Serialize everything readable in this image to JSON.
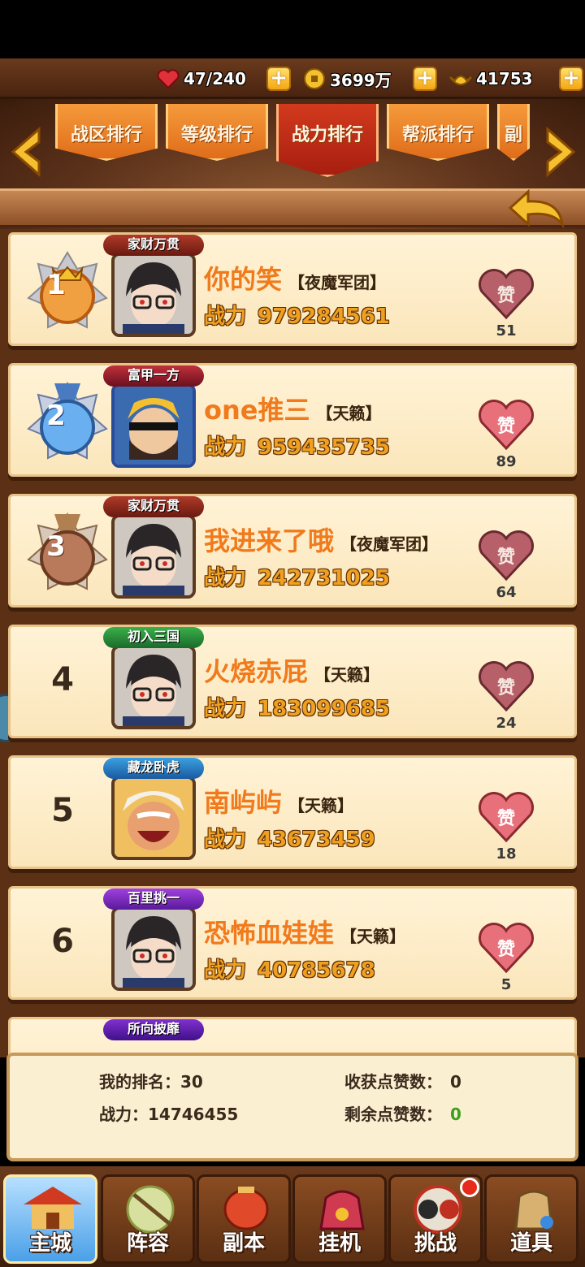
{
  "resources": {
    "stamina": "47/240",
    "coins": "3699万",
    "ingots": "41753"
  },
  "tabs": [
    "战区排行",
    "等级排行",
    "战力排行",
    "帮派排行",
    "副"
  ],
  "active_tab": "战力排行",
  "power_label": "战力",
  "rankings": [
    {
      "rank": "1",
      "name": "你的笑",
      "guild": "【夜魔军团】",
      "power": "979284561",
      "likes": "51",
      "badge": "家财万贯"
    },
    {
      "rank": "2",
      "name": "one推三",
      "guild": "【天籁】",
      "power": "959435735",
      "likes": "89",
      "badge": "富甲一方"
    },
    {
      "rank": "3",
      "name": "我进来了哦",
      "guild": "【夜魔军团】",
      "power": "242731025",
      "likes": "64",
      "badge": "家财万贯"
    },
    {
      "rank": "4",
      "name": "火烧赤屁",
      "guild": "【天籁】",
      "power": "183099685",
      "likes": "24",
      "badge": "初入三国"
    },
    {
      "rank": "5",
      "name": "南屿屿",
      "guild": "【天籁】",
      "power": "43673459",
      "likes": "18",
      "badge": "藏龙卧虎"
    },
    {
      "rank": "6",
      "name": "恐怖血娃娃",
      "guild": "【天籁】",
      "power": "40785678",
      "likes": "5",
      "badge": "百里挑一"
    },
    {
      "rank": "7",
      "name": "",
      "guild": "",
      "power": "",
      "likes": "",
      "badge": "所向披靡"
    }
  ],
  "my_info": {
    "rank_label": "我的排名：",
    "rank": "30",
    "power_label": "战力：",
    "power": "14746455",
    "received_label": "收获点赞数：",
    "received": "0",
    "remaining_label": "剩余点赞数：",
    "remaining": "0"
  },
  "nav": [
    "主城",
    "阵容",
    "副本",
    "挂机",
    "挑战",
    "道具"
  ],
  "colors": {
    "name": "#f07a1c",
    "power": "#f0a020",
    "active_tab": "#c02a16",
    "tab": "#ee8428",
    "remaining_value": "#3aa020"
  }
}
